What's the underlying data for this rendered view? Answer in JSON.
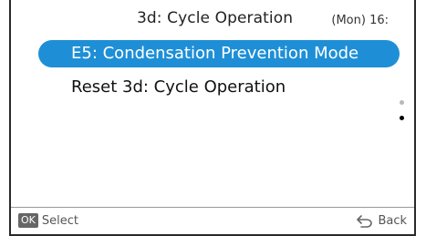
{
  "header": {
    "title": "3d: Cycle Operation",
    "clock": "(Mon) 16:"
  },
  "menu": {
    "items": [
      {
        "label": "E5: Condensation Prevention Mode",
        "selected": true
      },
      {
        "label": "Reset 3d: Cycle Operation",
        "selected": false
      }
    ]
  },
  "scrollbar": {
    "page_count": 2,
    "current_page": 2
  },
  "footer": {
    "ok_badge": "OK",
    "ok_label": "Select",
    "back_label": "Back"
  },
  "colors": {
    "accent": "#1e8fd6",
    "text": "#111111",
    "hint": "#555555"
  },
  "icons": {
    "back": "back-arrow-icon"
  }
}
